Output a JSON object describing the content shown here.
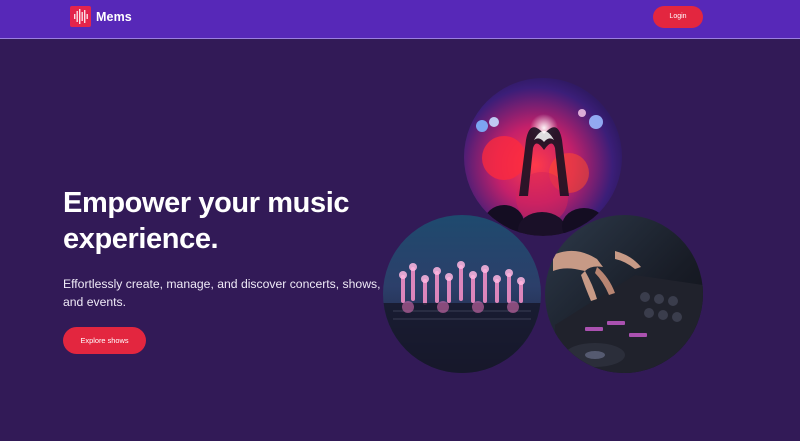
{
  "header": {
    "brand_name": "Mems",
    "logo_icon": "equalizer-icon",
    "login_label": "Login"
  },
  "hero": {
    "title": "Empower your music experience.",
    "subtitle": "Effortlessly create, manage, and discover concerts, shows, and events.",
    "cta_label": "Explore shows"
  },
  "gallery": {
    "images": [
      "heart-hands-concert-photo",
      "festival-crowd-photo",
      "dj-mixer-photo"
    ]
  },
  "colors": {
    "header_bg": "#5728b8",
    "page_bg": "#321a57",
    "accent": "#e3263f"
  }
}
